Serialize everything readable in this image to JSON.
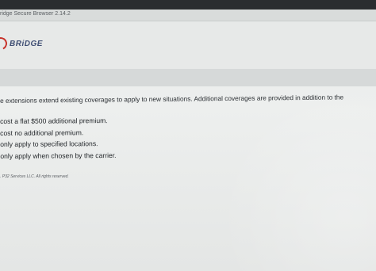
{
  "window": {
    "title": "ridge Secure Browser 2.14.2"
  },
  "header": {
    "logo_text": "BRiDGE"
  },
  "question": {
    "text": "e extensions extend existing coverages to apply to new situations. Additional coverages are provided in addition to the"
  },
  "answers": [
    "cost a flat $500 additional premium.",
    "cost no additional premium.",
    "only apply to specified locations.",
    "only apply when chosen by the carrier."
  ],
  "footer": {
    "copyright": ". P32 Services LLC. All rights reserved."
  },
  "colors": {
    "brand_red": "#c8342c",
    "brand_navy": "#3f4e73",
    "bezel": "#2a2d30"
  }
}
